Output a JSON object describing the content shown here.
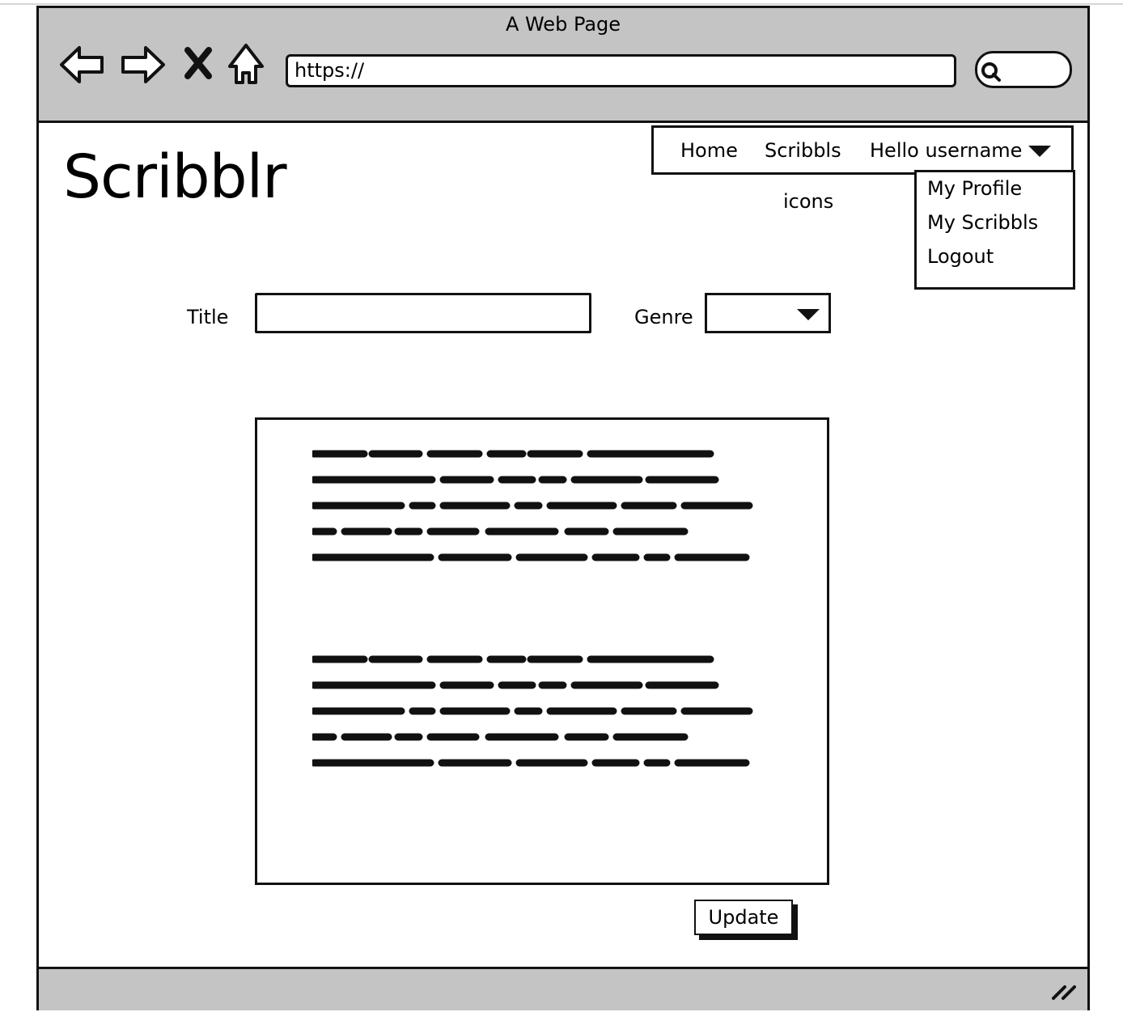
{
  "browser": {
    "window_title": "A Web Page",
    "address": "https://",
    "icons": {
      "back": "back-arrow-icon",
      "forward": "forward-arrow-icon",
      "stop": "close-x-icon",
      "home": "home-icon",
      "search": "search-icon",
      "resize": "resize-grip-icon"
    }
  },
  "header": {
    "logo": "Scribblr",
    "nav": {
      "home": "Home",
      "scribbls": "Scribbls",
      "user_menu": "Hello username"
    },
    "icons_placeholder": "icons"
  },
  "user_dropdown": {
    "items": [
      {
        "label": "My Profile"
      },
      {
        "label": "My Scribbls"
      },
      {
        "label": "Logout"
      }
    ]
  },
  "form": {
    "title_label": "Title",
    "title_value": "",
    "genre_label": "Genre",
    "genre_value": "",
    "body_paragraph_count": 2,
    "update_button": "Update"
  }
}
